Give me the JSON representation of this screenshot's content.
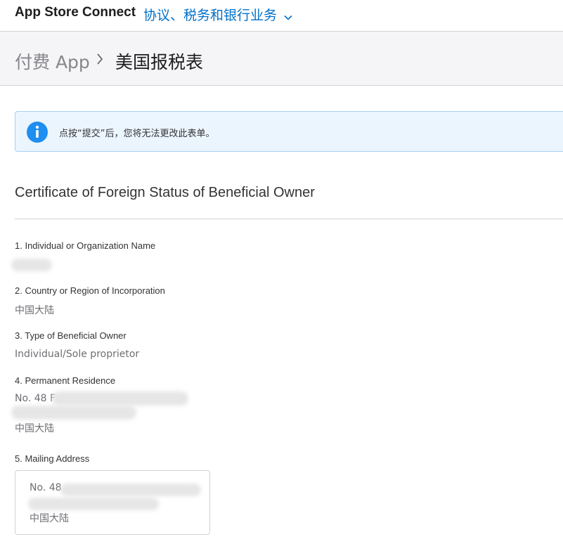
{
  "topbar": {
    "app_title": "App Store Connect",
    "section_menu": "协议、税务和银行业务",
    "section_menu_icon": "chevron-down-icon"
  },
  "breadcrumb": {
    "parent": "付费 App",
    "separator_icon": "chevron-right-icon",
    "current": "美国报税表"
  },
  "notice": {
    "icon": "info-icon",
    "text": "点按“提交”后，您将无法更改此表单。"
  },
  "form": {
    "title": "Certificate of Foreign Status of Beneficial Owner",
    "fields": [
      {
        "label": "1. Individual or Organization Name",
        "value": ""
      },
      {
        "label": "2. Country or Region of Incorporation",
        "value": "中国大陆"
      },
      {
        "label": "3. Type of Beneficial Owner",
        "value": "Individual/Sole proprietor"
      },
      {
        "label": "4. Permanent Residence",
        "line1": "No. 48 F",
        "line3": "中国大陆"
      },
      {
        "label": "5. Mailing Address",
        "line1": "No. 48",
        "line3": "中国大陆"
      }
    ]
  },
  "colors": {
    "link_blue": "#0070c9",
    "info_blue": "#1f8ef1",
    "notice_bg": "#ebf5fe",
    "band_bg": "#f5f5f7"
  }
}
